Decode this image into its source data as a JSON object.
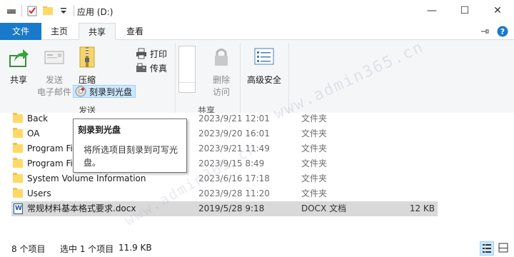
{
  "window": {
    "title": "应用 (D:)",
    "minimize_glyph": "—",
    "maximize_glyph": "☐",
    "close_glyph": "✕"
  },
  "tabs": {
    "file": "文件",
    "home": "主页",
    "share": "共享",
    "view": "查看"
  },
  "ribbon": {
    "share_btn": "共享",
    "email_line1": "发送",
    "email_line2": "电子邮件",
    "zip": "压缩",
    "print": "打印",
    "fax": "传真",
    "burn": "刻录到光盘",
    "remove_line1": "删除",
    "remove_line2": "访问",
    "advanced_security": "高级安全",
    "group_send": "发送",
    "group_share": "共享"
  },
  "tooltip": {
    "title": "刻录到光盘",
    "body": "将所选项目刻录到可写光盘。"
  },
  "files": [
    {
      "name": "Back",
      "date": "2023/9/21 12:01",
      "type": "文件夹",
      "size": "",
      "icon": "folder-icon"
    },
    {
      "name": "OA",
      "date": "2023/9/20 16:01",
      "type": "文件夹",
      "size": "",
      "icon": "folder-icon"
    },
    {
      "name": "Program Files",
      "date": "2023/9/21 11:49",
      "type": "文件夹",
      "size": "",
      "icon": "folder-icon"
    },
    {
      "name": "Program Files (x86)",
      "date": "2023/9/15 8:49",
      "type": "文件夹",
      "size": "",
      "icon": "folder-icon"
    },
    {
      "name": "System Volume Information",
      "date": "2023/6/16 17:18",
      "type": "文件夹",
      "size": "",
      "icon": "folder-icon"
    },
    {
      "name": "Users",
      "date": "2023/9/28 11:20",
      "type": "文件夹",
      "size": "",
      "icon": "folder-icon"
    },
    {
      "name": "常规材料基本格式要求.docx",
      "date": "2019/5/28 9:18",
      "type": "DOCX 文档",
      "size": "12 KB",
      "icon": "word-doc-icon"
    }
  ],
  "status": {
    "count": "8 个项目",
    "selected": "选中 1 个项目",
    "size": "11.9 KB"
  },
  "watermark": "www.admin365.cn",
  "colors": {
    "file_tab": "#1979ca",
    "selection": "#d9d9d9",
    "hover": "#cce8ff"
  }
}
